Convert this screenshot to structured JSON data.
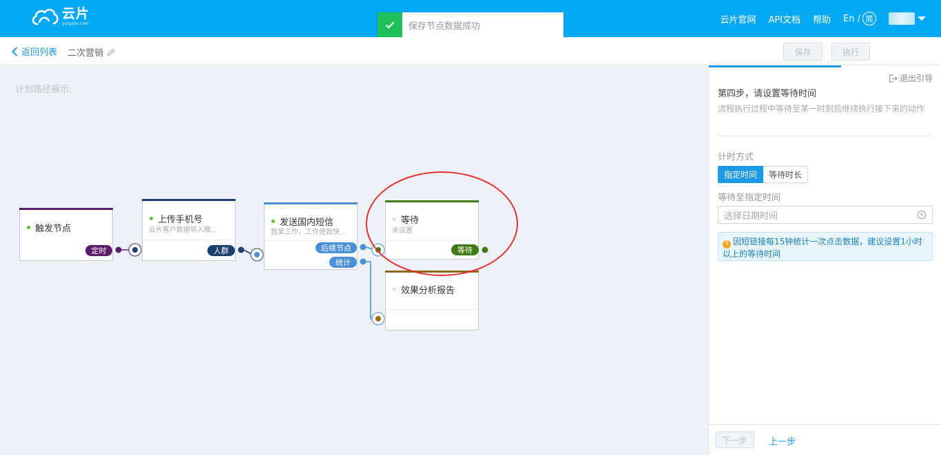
{
  "header": {
    "logo_cn": "云片",
    "logo_en": "yunpian.com",
    "nav": [
      "云片官网",
      "API文档",
      "帮助"
    ],
    "lang_en": "En /",
    "lang_cn": "简"
  },
  "toast": {
    "text": "保存节点数据成功"
  },
  "subbar": {
    "back_label": "返回列表",
    "plan_name": "二次营销",
    "save_label": "保存",
    "execute_label": "执行"
  },
  "canvas": {
    "title": "计划路径展示:",
    "nodes": [
      {
        "title": "触发节点",
        "subtitle": "",
        "tags": [
          "定时"
        ],
        "bar_color": "#5b1c6b"
      },
      {
        "title": "上传手机号",
        "subtitle": "云片客户数据导入模...",
        "tags": [
          "人群"
        ],
        "bar_color": "#1b3f6e"
      },
      {
        "title": "发送国内短信",
        "subtitle": "我爱工作，工作使我快...",
        "tags": [
          "后续节点",
          "统计"
        ],
        "bar_color": "#4a90d9"
      },
      {
        "title": "等待",
        "subtitle": "未设置",
        "tags": [
          "等待"
        ],
        "bar_color": "#3f7a12"
      },
      {
        "title": "效果分析报告",
        "subtitle": "",
        "tags": [],
        "bar_color": "#8a6a1a"
      }
    ]
  },
  "panel": {
    "exit_guide": "退出引导",
    "step_title": "第四步，请设置等待时间",
    "step_desc": "流程执行过程中等待至某一时刻后继续执行接下来的动作",
    "timing_label": "计时方式",
    "timing_options": [
      "指定时间",
      "等待时长"
    ],
    "wait_until_label": "等待至指定时间",
    "datetime_placeholder": "选择日期时间",
    "notice": "因短链接每15钟统计一次点击数据，建议设置1小时以上的等待时间",
    "next_label": "下一步",
    "prev_label": "上一步"
  },
  "colors": {
    "header_bg": "#03a9f4",
    "accent": "#1d9ae6",
    "success": "#1fbf5c",
    "canvas_bg": "#eef1f5",
    "highlight": "#e43030"
  }
}
